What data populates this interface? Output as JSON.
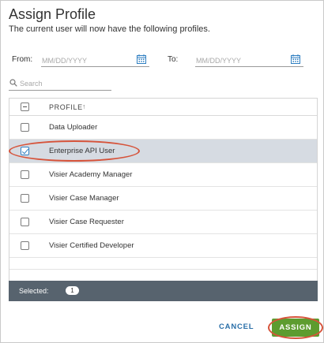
{
  "dialog": {
    "title": "Assign Profile",
    "subtitle": "The current user will now have the following profiles."
  },
  "filters": {
    "from_label": "From:",
    "from_placeholder": "MM/DD/YYYY",
    "to_label": "To:",
    "to_placeholder": "MM/DD/YYYY",
    "search_placeholder": "Search"
  },
  "table": {
    "column_header": "PROFILE",
    "sort_indicator": "↑",
    "rows": [
      {
        "label": "Data Uploader",
        "checked": false
      },
      {
        "label": "Enterprise API User",
        "checked": true
      },
      {
        "label": "Visier Academy Manager",
        "checked": false
      },
      {
        "label": "Visier Case Manager",
        "checked": false
      },
      {
        "label": "Visier Case Requester",
        "checked": false
      },
      {
        "label": "Visier Certified Developer",
        "checked": false
      }
    ]
  },
  "footer": {
    "selected_label": "Selected:",
    "selected_count": "1"
  },
  "actions": {
    "cancel_label": "CANCEL",
    "assign_label": "ASSIGN"
  },
  "colors": {
    "accent_blue": "#2d7ec1",
    "assign_green": "#5d9c2f",
    "highlight_red": "#d6533a",
    "footer_bar": "#57636e",
    "selected_row": "#d6dbe2"
  },
  "icons": {
    "calendar": "calendar-icon",
    "search": "search-icon",
    "sort": "sort-ascending-icon"
  }
}
